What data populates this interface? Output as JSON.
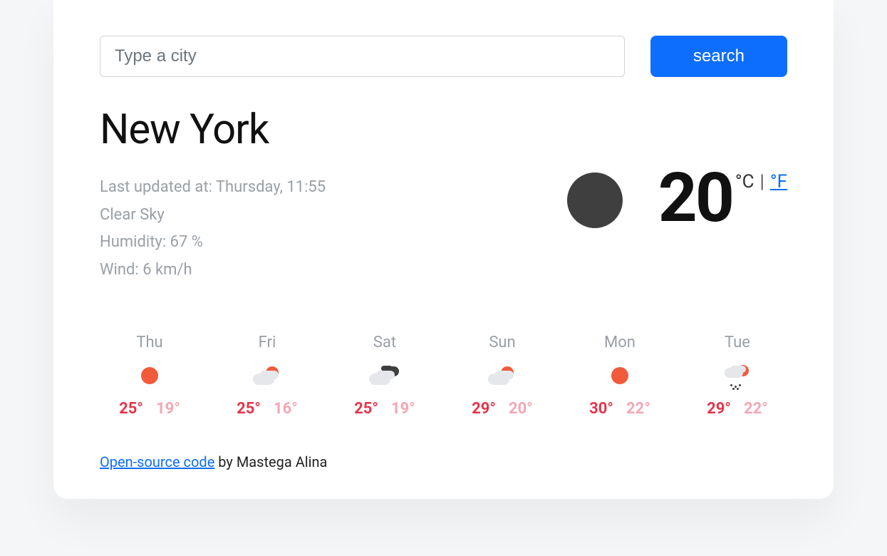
{
  "search": {
    "placeholder": "Type a city",
    "button_label": "search"
  },
  "current": {
    "city": "New York",
    "last_updated_label": "Last updated at: Thursday, 11:55",
    "condition": "Clear Sky",
    "humidity_label": "Humidity: 67 %",
    "wind_label": "Wind: 6 km/h",
    "temp": "20",
    "unit_c": "°C",
    "unit_sep": "|",
    "unit_f": "°F",
    "icon": "dark-circle"
  },
  "forecast": [
    {
      "day": "Thu",
      "icon": "sun",
      "hi": "25°",
      "lo": "19°"
    },
    {
      "day": "Fri",
      "icon": "cloud-sun",
      "hi": "25°",
      "lo": "16°"
    },
    {
      "day": "Sat",
      "icon": "cloudy",
      "hi": "25°",
      "lo": "19°"
    },
    {
      "day": "Sun",
      "icon": "cloud-sun",
      "hi": "29°",
      "lo": "20°"
    },
    {
      "day": "Mon",
      "icon": "sun",
      "hi": "30°",
      "lo": "22°"
    },
    {
      "day": "Tue",
      "icon": "rain-sun",
      "hi": "29°",
      "lo": "22°"
    }
  ],
  "footer": {
    "link_text": "Open-source code",
    "by_text": " by Mastega Alina"
  }
}
